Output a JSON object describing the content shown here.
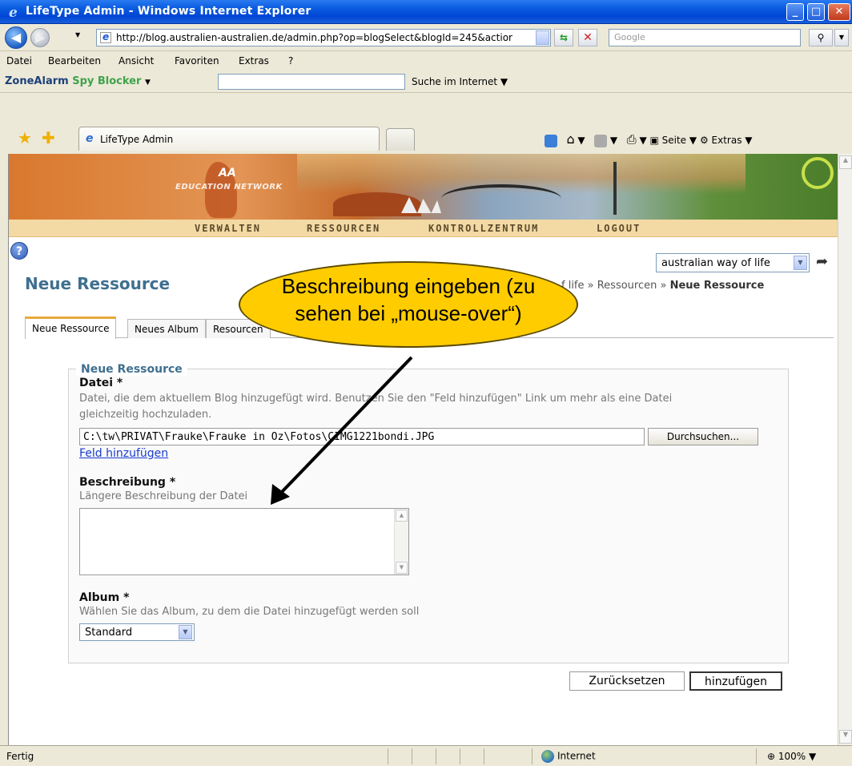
{
  "window": {
    "title": "LifeType Admin - Windows Internet Explorer"
  },
  "address": {
    "url": "http://blog.australien-australien.de/admin.php?op=blogSelect&blogId=245&actior",
    "search_placeholder": "Google"
  },
  "menu": [
    "Datei",
    "Bearbeiten",
    "Ansicht",
    "Favoriten",
    "Extras",
    "?"
  ],
  "zonealarm": {
    "logo_zone": "ZoneAlarm",
    "logo_spy": "Spy Blocker",
    "search_label": "Suche im Internet"
  },
  "browser_tab": {
    "label": "LifeType Admin"
  },
  "commandbar": {
    "page_label": "Seite",
    "tools_label": "Extras"
  },
  "banner": {
    "logo_initials": "AA",
    "logo_text": "EDUCATION NETWORK"
  },
  "main_nav": [
    "VERWALTEN",
    "RESSOURCEN",
    "KONTROLLZENTRUM",
    "LOGOUT"
  ],
  "blog_select": {
    "value": "australian way of life"
  },
  "page": {
    "title": "Neue Ressource",
    "breadcrumb_prefix": "f life » Ressourcen » ",
    "breadcrumb_current": "Neue Ressource"
  },
  "tabs": [
    "Neue Ressource",
    "Neues Album",
    "Resourcen"
  ],
  "form": {
    "legend": "Neue Ressource",
    "file_label": "Datei *",
    "file_desc_line1": "Datei, die dem aktuellem Blog hinzugefügt wird. Benutzen Sie den \"Feld hinzufügen\" Link um mehr als eine Datei",
    "file_desc_line2": "gleichzeitig hochzuladen.",
    "file_value": "C:\\tw\\PRIVAT\\Frauke\\Frauke in Oz\\Fotos\\CIMG1221bondi.JPG",
    "browse_label": "Durchsuchen...",
    "add_field_link": "Feld hinzufügen",
    "description_label": "Beschreibung *",
    "description_desc": "Längere Beschreibung der Datei",
    "description_value": "",
    "album_label": "Album *",
    "album_desc": "Wählen Sie das Album, zu dem die Datei hinzugefügt werden soll",
    "album_value": "Standard",
    "reset_label": "Zurücksetzen",
    "submit_label": "hinzufügen"
  },
  "callout": {
    "line1": "Beschreibung eingeben (zu",
    "line2": "sehen bei „mouse-over“)"
  },
  "status": {
    "text": "Fertig",
    "zone": "Internet",
    "zoom": "100%"
  },
  "colors": {
    "callout": "#ffcc00",
    "accent_title": "#3f6f8f",
    "nav_band": "#f3d9a4",
    "titlebar": "#0046d5"
  }
}
